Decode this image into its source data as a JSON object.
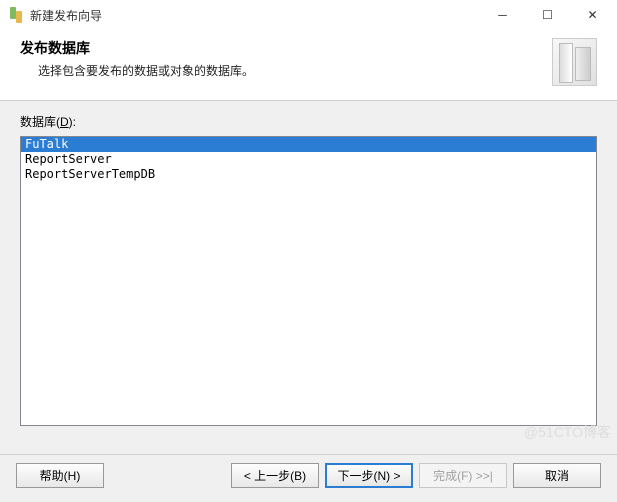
{
  "window": {
    "title": "新建发布向导"
  },
  "header": {
    "title": "发布数据库",
    "subtitle": "选择包含要发布的数据或对象的数据库。"
  },
  "body": {
    "list_label_prefix": "数据库(",
    "list_label_key": "D",
    "list_label_suffix": "):",
    "items": [
      {
        "text": "FuTalk",
        "selected": true
      },
      {
        "text": "ReportServer",
        "selected": false
      },
      {
        "text": "ReportServerTempDB",
        "selected": false
      }
    ]
  },
  "buttons": {
    "help": "帮助(H)",
    "back": "< 上一步(B)",
    "next": "下一步(N) >",
    "finish": "完成(F) >>|",
    "cancel": "取消"
  },
  "watermark": "@51CTO博客"
}
